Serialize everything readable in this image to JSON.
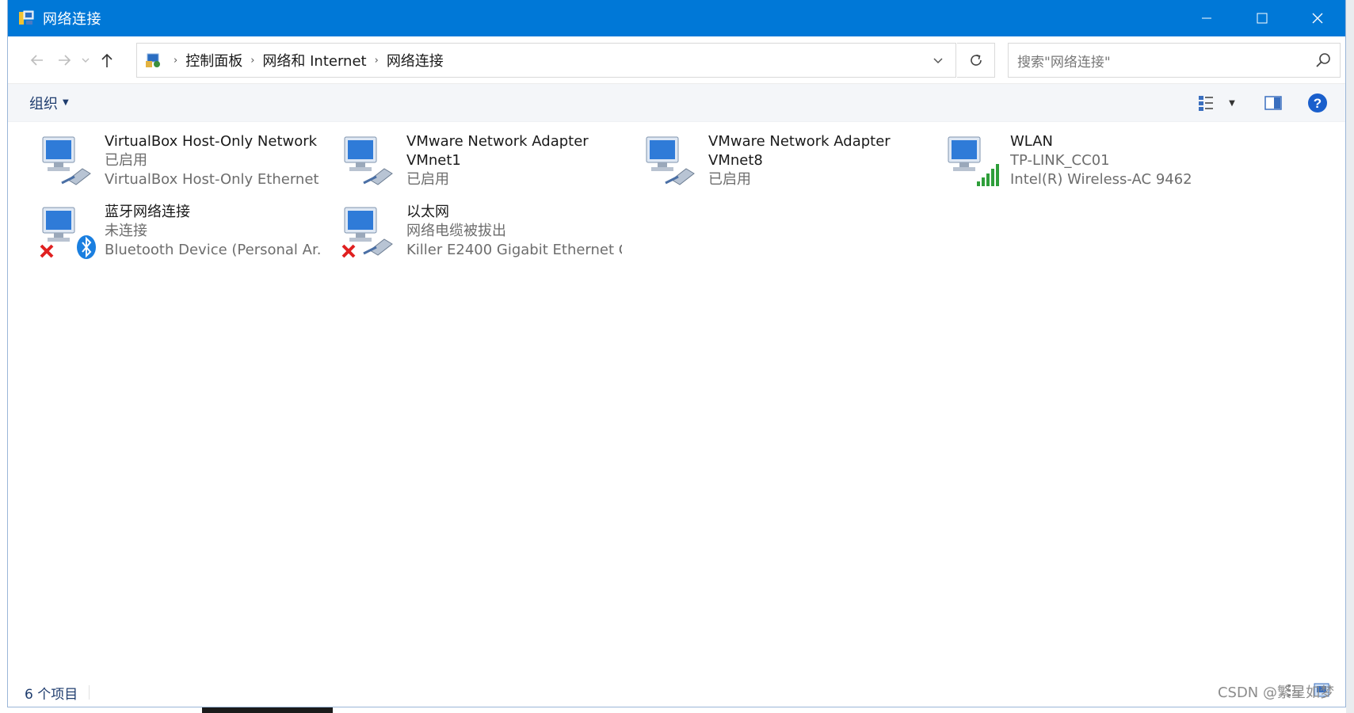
{
  "window": {
    "title": "网络连接",
    "controls": [
      "minimize-icon",
      "maximize-icon",
      "close-icon"
    ],
    "accent_color": "#0078d7"
  },
  "address": {
    "breadcrumbs": [
      "控制面板",
      "网络和 Internet",
      "网络连接"
    ],
    "search_placeholder": "搜索\"网络连接\""
  },
  "commandbar": {
    "organize_label": "组织"
  },
  "connections": [
    {
      "name": "VirtualBox Host-Only Network",
      "name2": "",
      "status": "已启用",
      "device": "VirtualBox Host-Only Ethernet ...",
      "icon": "ethernet-icon",
      "badge": ""
    },
    {
      "name": "VMware Network Adapter",
      "name2": "VMnet1",
      "status": "已启用",
      "device": "",
      "icon": "ethernet-icon",
      "badge": ""
    },
    {
      "name": "VMware Network Adapter",
      "name2": "VMnet8",
      "status": "已启用",
      "device": "",
      "icon": "ethernet-icon",
      "badge": ""
    },
    {
      "name": "WLAN",
      "name2": "",
      "status": "TP-LINK_CC01",
      "device": "Intel(R) Wireless-AC 9462",
      "icon": "wifi-signal-icon",
      "badge": ""
    },
    {
      "name": "蓝牙网络连接",
      "name2": "",
      "status": "未连接",
      "device": "Bluetooth Device (Personal Ar...",
      "icon": "bluetooth-icon",
      "badge": "disconnected-x-icon"
    },
    {
      "name": "以太网",
      "name2": "",
      "status": "网络电缆被拔出",
      "device": "Killer E2400 Gigabit Ethernet C...",
      "icon": "ethernet-icon",
      "badge": "disconnected-x-icon"
    }
  ],
  "statusbar": {
    "count": "6 个项目"
  },
  "watermark": "CSDN @繁星如梦"
}
